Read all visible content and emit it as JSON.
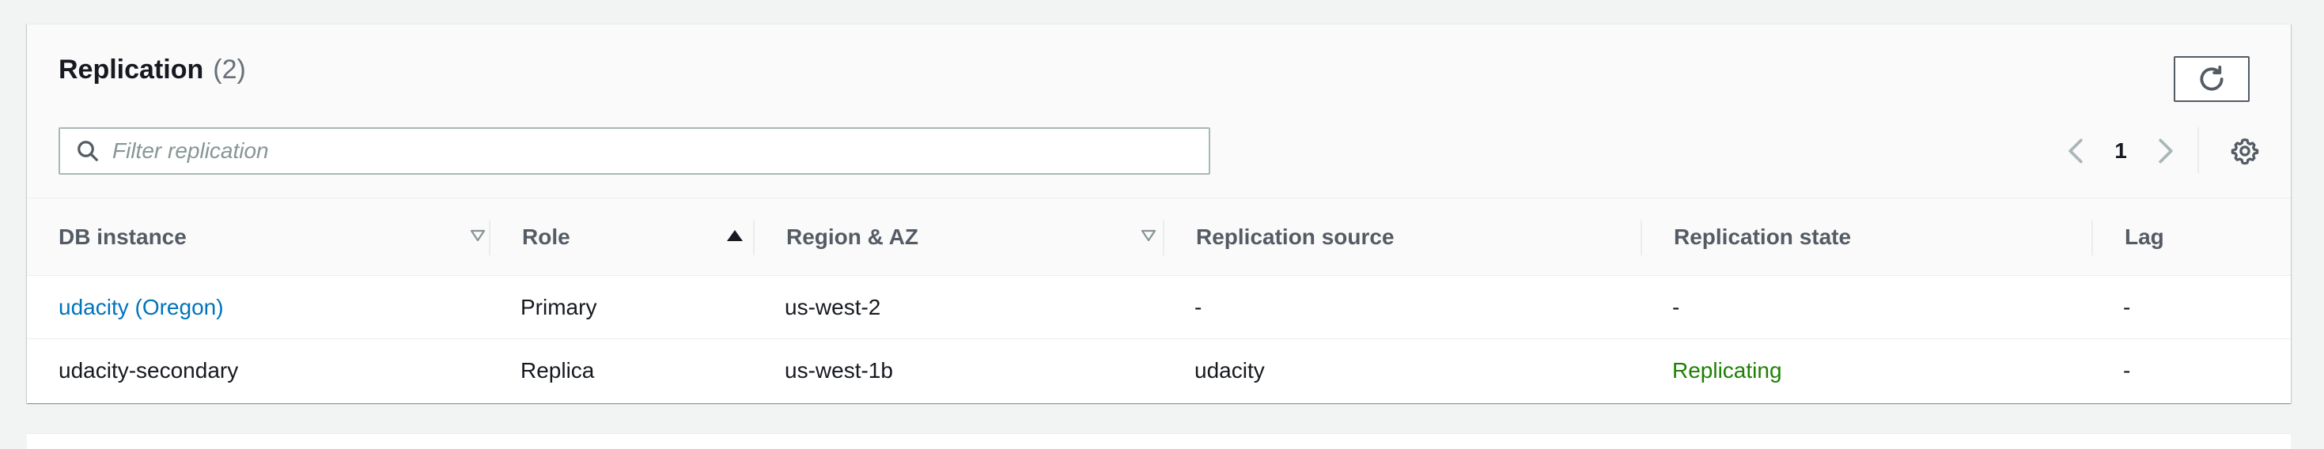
{
  "header": {
    "title": "Replication",
    "count": "(2)",
    "refresh_icon": "refresh-icon"
  },
  "search": {
    "placeholder": "Filter replication",
    "value": "",
    "icon": "search-icon"
  },
  "pagination": {
    "current_page": "1",
    "prev_icon": "chevron-left-icon",
    "next_icon": "chevron-right-icon",
    "settings_icon": "gear-icon"
  },
  "table": {
    "columns": [
      {
        "label": "DB instance",
        "sort": "sortable"
      },
      {
        "label": "Role",
        "sort": "ascending"
      },
      {
        "label": "Region & AZ",
        "sort": "sortable"
      },
      {
        "label": "Replication source",
        "sort": "none"
      },
      {
        "label": "Replication state",
        "sort": "none"
      },
      {
        "label": "Lag",
        "sort": "none"
      }
    ],
    "rows": [
      {
        "db_instance": "udacity (Oregon)",
        "role": "Primary",
        "region": "us-west-2",
        "source": "-",
        "state": "-",
        "lag": "-"
      },
      {
        "db_instance": "udacity-secondary",
        "role": "Replica",
        "region": "us-west-1b",
        "source": "udacity",
        "state": "Replicating",
        "lag": "-"
      }
    ]
  },
  "colors": {
    "link": "#0073bb",
    "status_success": "#1d8102",
    "heading": "#16191f",
    "muted": "#687078"
  }
}
